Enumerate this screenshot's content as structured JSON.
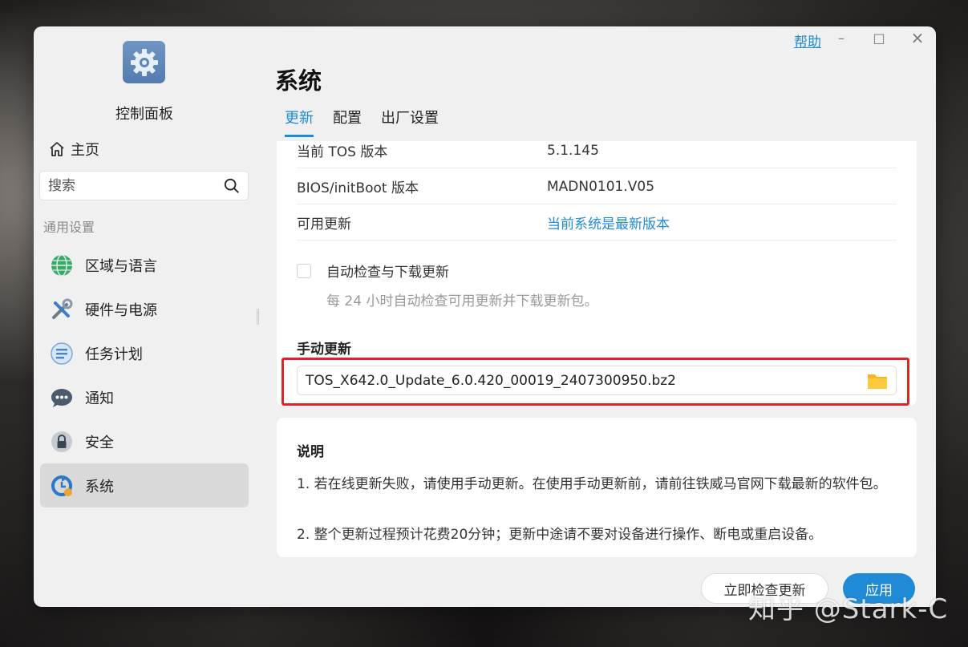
{
  "app": {
    "title": "控制面板"
  },
  "window": {
    "help": "帮助",
    "minimize": "–",
    "maximize": "□",
    "close": "×"
  },
  "sidebar": {
    "home": "主页",
    "search_placeholder": "搜索",
    "section": "通用设置",
    "items": [
      {
        "label": "区域与语言",
        "icon": "globe-icon"
      },
      {
        "label": "硬件与电源",
        "icon": "tools-icon"
      },
      {
        "label": "任务计划",
        "icon": "task-icon"
      },
      {
        "label": "通知",
        "icon": "chat-icon"
      },
      {
        "label": "安全",
        "icon": "lock-icon"
      },
      {
        "label": "系统",
        "icon": "system-update-icon",
        "active": true
      }
    ]
  },
  "main": {
    "title": "系统",
    "tabs": [
      {
        "label": "更新",
        "active": true
      },
      {
        "label": "配置"
      },
      {
        "label": "出厂设置"
      }
    ],
    "info": [
      {
        "key": "当前 TOS 版本",
        "value": "5.1.145"
      },
      {
        "key": "BIOS/initBoot 版本",
        "value": "MADN0101.V05"
      },
      {
        "key": "可用更新",
        "value": "当前系统是最新版本"
      }
    ],
    "auto_update": {
      "label": "自动检查与下载更新",
      "checked": false,
      "description": "每 24 小时自动检查可用更新并下载更新包。"
    },
    "manual": {
      "title": "手动更新",
      "file": "TOS_X642.0_Update_6.0.420_00019_2407300950.bz2"
    },
    "notes": {
      "title": "说明",
      "items": [
        "1. 若在线更新失败，请使用手动更新。在使用手动更新前，请前往铁威马官网下载最新的软件包。",
        "2. 整个更新过程预计花费20分钟；更新中途请不要对设备进行操作、断电或重启设备。"
      ]
    },
    "buttons": {
      "check": "立即检查更新",
      "apply": "应用"
    }
  },
  "watermark": "知乎 @Stark-C",
  "colors": {
    "accent": "#1f8ad6",
    "highlight_border": "#e0232a"
  }
}
